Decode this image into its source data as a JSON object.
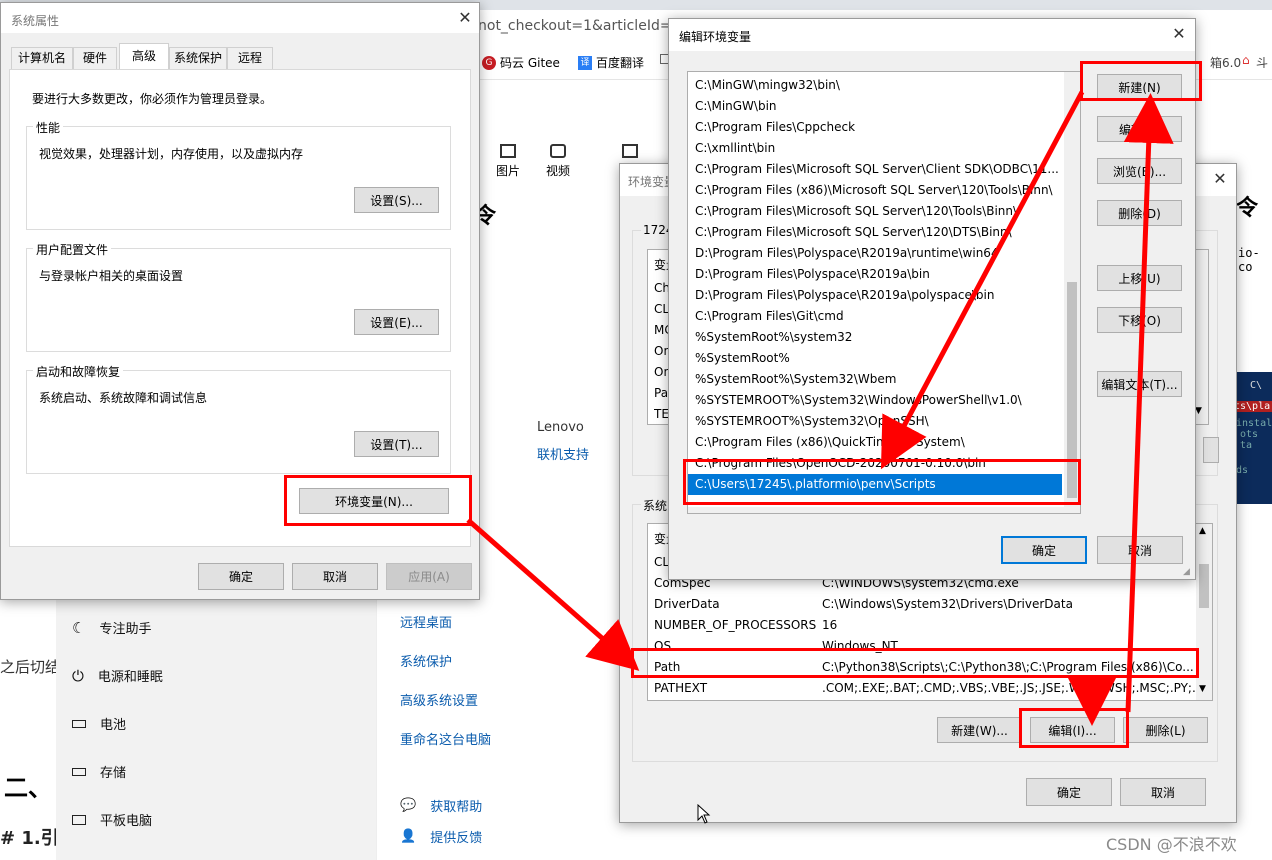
{
  "browser": {
    "url_fragment": "not_checkout=1&articleId=1",
    "bookmarks": [
      "码云 Gitee",
      "百度翻译"
    ],
    "right_tabs": [
      "箱6.0",
      "斗"
    ],
    "toolbar_items": [
      "图片",
      "视频"
    ],
    "heading_glyph": "令",
    "right_heading_glyph": "令",
    "side_snippet": "io-co",
    "page_frag_text": "之后切结",
    "page_heading": "二、",
    "page_subheading": "# 1.引",
    "terminal_lines": [
      "C\\",
      "ts\\pla",
      "install",
      "ots ta",
      "ds"
    ]
  },
  "settings": {
    "nav": [
      {
        "label": "专注助手",
        "icon": "moon-icon"
      },
      {
        "label": "电源和睡眠",
        "icon": "power-icon"
      },
      {
        "label": "电池",
        "icon": "battery-icon"
      },
      {
        "label": "存储",
        "icon": "storage-icon"
      },
      {
        "label": "平板电脑",
        "icon": "tablet-icon"
      }
    ],
    "vendor": "Lenovo",
    "vendor_link": "联机支持",
    "links": [
      "远程桌面",
      "系统保护",
      "高级系统设置",
      "重命名这台电脑"
    ],
    "help": "获取帮助",
    "feedback": "提供反馈"
  },
  "sysprops": {
    "title": "系统属性",
    "tabs": [
      "计算机名",
      "硬件",
      "高级",
      "系统保护",
      "远程"
    ],
    "active_tab": "高级",
    "admin_note": "要进行大多数更改，你必须作为管理员登录。",
    "perf_legend": "性能",
    "perf_desc": "视觉效果，处理器计划，内存使用，以及虚拟内存",
    "perf_btn": "设置(S)...",
    "profile_legend": "用户配置文件",
    "profile_desc": "与登录帐户相关的桌面设置",
    "profile_btn": "设置(E)...",
    "startup_legend": "启动和故障恢复",
    "startup_desc": "系统启动、系统故障和调试信息",
    "startup_btn": "设置(T)...",
    "env_btn": "环境变量(N)...",
    "ok": "确定",
    "cancel": "取消",
    "apply": "应用(A)"
  },
  "envvars": {
    "title": "环境变量",
    "user_group_prefix": "1724",
    "user_header": "变量",
    "user_vars": [
      "Ch",
      "CLi",
      "MC",
      "On",
      "On",
      "Pat",
      "TE"
    ],
    "sys_group_prefix": "系统",
    "sys_header": "变量",
    "sys_rows": [
      {
        "name": "CL",
        "value": ""
      },
      {
        "name": "ComSpec",
        "value": "C:\\WINDOWS\\system32\\cmd.exe"
      },
      {
        "name": "DriverData",
        "value": "C:\\Windows\\System32\\Drivers\\DriverData"
      },
      {
        "name": "NUMBER_OF_PROCESSORS",
        "value": "16"
      },
      {
        "name": "OS",
        "value": "Windows_NT"
      },
      {
        "name": "Path",
        "value": "C:\\Python38\\Scripts\\;C:\\Python38\\;C:\\Program Files (x86)\\Co..."
      },
      {
        "name": "PATHEXT",
        "value": ".COM;.EXE;.BAT;.CMD;.VBS;.VBE;.JS;.JSE;.WSF;.WSH;.MSC;.PY;.P..."
      }
    ],
    "new_btn": "新建(W)...",
    "edit_btn": "编辑(I)...",
    "delete_btn": "删除(L)",
    "ok": "确定",
    "cancel": "取消"
  },
  "editenv": {
    "title": "编辑环境变量",
    "paths": [
      "C:\\MinGW\\mingw32\\bin\\",
      "C:\\MinGW\\bin",
      "C:\\Program Files\\Cppcheck",
      "C:\\xmllint\\bin",
      "C:\\Program Files\\Microsoft SQL Server\\Client SDK\\ODBC\\11...",
      "C:\\Program Files (x86)\\Microsoft SQL Server\\120\\Tools\\Binn\\",
      "C:\\Program Files\\Microsoft SQL Server\\120\\Tools\\Binn\\",
      "C:\\Program Files\\Microsoft SQL Server\\120\\DTS\\Binn\\",
      "D:\\Program Files\\Polyspace\\R2019a\\runtime\\win64",
      "D:\\Program Files\\Polyspace\\R2019a\\bin",
      "D:\\Program Files\\Polyspace\\R2019a\\polyspace\\bin",
      "C:\\Program Files\\Git\\cmd",
      "%SystemRoot%\\system32",
      "%SystemRoot%",
      "%SystemRoot%\\System32\\Wbem",
      "%SYSTEMROOT%\\System32\\WindowsPowerShell\\v1.0\\",
      "%SYSTEMROOT%\\System32\\OpenSSH\\",
      "C:\\Program Files (x86)\\QuickTime\\QTSystem\\",
      "C:\\Program Files\\OpenOCD-20200701-0.10.0\\bin",
      "C:\\Users\\17245\\.platformio\\penv\\Scripts"
    ],
    "selected_index": 19,
    "buttons": [
      "新建(N)",
      "编辑(E)",
      "浏览(B)...",
      "删除(D)",
      "上移(U)",
      "下移(O)",
      "编辑文本(T)..."
    ],
    "ok": "确定",
    "cancel": "取消"
  },
  "watermark": "CSDN @不浪不欢",
  "colors": {
    "annotation": "#ff0000",
    "selection": "#0078d7",
    "link": "#0b5cad"
  }
}
